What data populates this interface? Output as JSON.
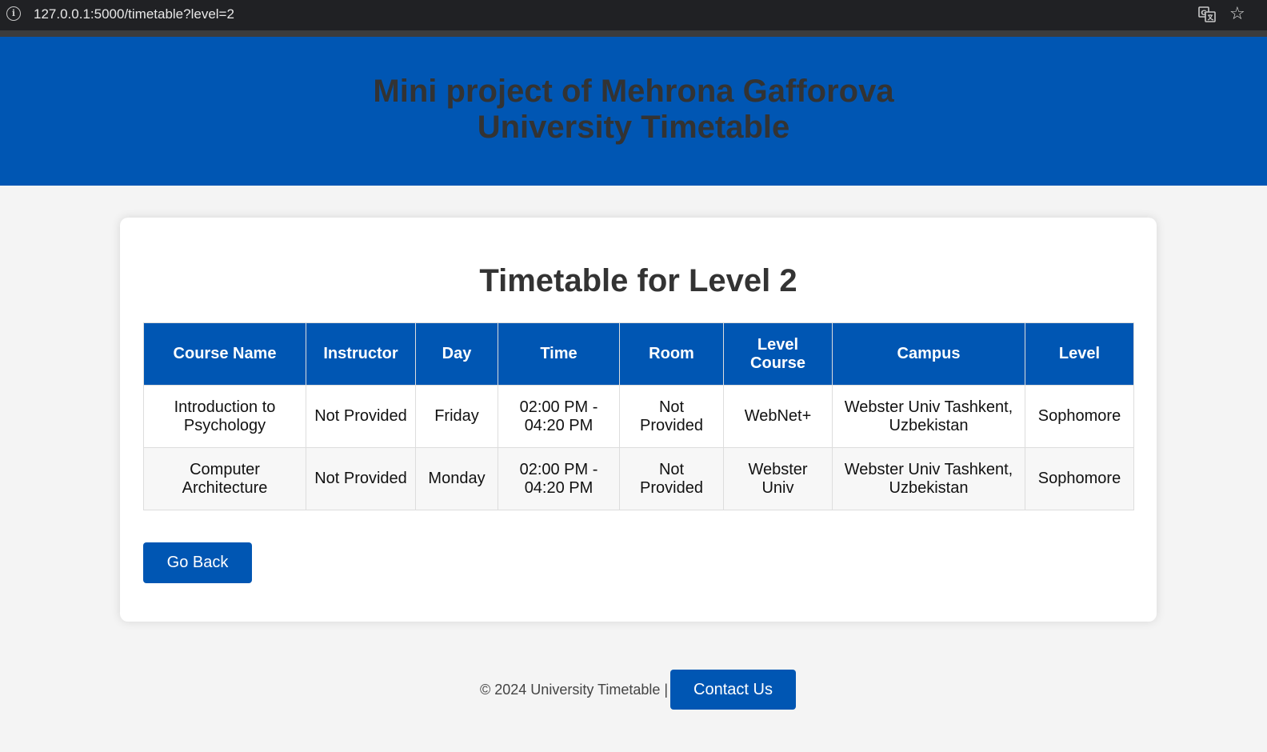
{
  "browser": {
    "url": "127.0.0.1:5000/timetable?level=2",
    "info_glyph": "i",
    "star_glyph": "☆"
  },
  "header": {
    "line1": "Mini project of Mehrona Gafforova",
    "line2": "University Timetable"
  },
  "main": {
    "title": "Timetable for Level 2",
    "columns": [
      "Course Name",
      "Instructor",
      "Day",
      "Time",
      "Room",
      "Level Course",
      "Campus",
      "Level"
    ],
    "rows": [
      [
        "Introduction to Psychology",
        "Not Provided",
        "Friday",
        "02:00 PM - 04:20 PM",
        "Not Provided",
        "WebNet+",
        "Webster Univ Tashkent, Uzbekistan",
        "Sophomore"
      ],
      [
        "Computer Architecture",
        "Not Provided",
        "Monday",
        "02:00 PM - 04:20 PM",
        "Not Provided",
        "Webster Univ",
        "Webster Univ Tashkent, Uzbekistan",
        "Sophomore"
      ]
    ],
    "go_back_label": "Go Back"
  },
  "footer": {
    "copyright": "© 2024 University Timetable |",
    "contact_label": "Contact Us"
  },
  "colors": {
    "brand_blue": "#0056b3",
    "page_bg": "#f4f4f4",
    "header_text": "#333333"
  },
  "icons": [
    "info-icon",
    "translate-icon",
    "star-icon"
  ]
}
